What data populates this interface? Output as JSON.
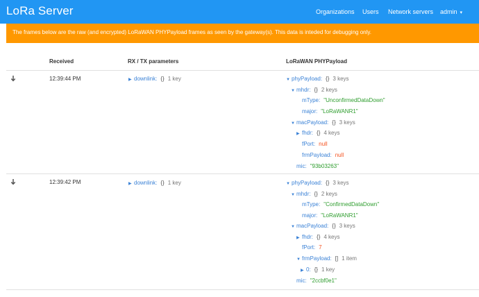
{
  "appbar": {
    "title": "LoRa Server",
    "nav": {
      "organizations": "Organizations",
      "users": "Users",
      "network_servers": "Network servers",
      "account": "admin",
      "account_caret": "▾"
    }
  },
  "banner": {
    "text": "The frames below are the raw (and encrypted) LoRaWAN PHYPayload frames as seen by the gateway(s). This data is inteded for debugging only."
  },
  "table": {
    "headers": {
      "received": "Received",
      "rxtx": "RX / TX parameters",
      "phypayload": "LoRaWAN PHYPayload"
    },
    "rows": [
      {
        "received": "12:39:44 PM",
        "rxtx": {
          "key": "downlink",
          "brace": "{}",
          "meta": "1 key"
        },
        "tree": {
          "phyPayload": {
            "key": "phyPayload",
            "brace": "{}",
            "meta": "3 keys"
          },
          "mhdr": {
            "key": "mhdr",
            "brace": "{}",
            "meta": "2 keys"
          },
          "mType": {
            "key": "mType",
            "value": "\"UnconfirmedDataDown\""
          },
          "major": {
            "key": "major",
            "value": "\"LoRaWANR1\""
          },
          "macPayload": {
            "key": "macPayload",
            "brace": "{}",
            "meta": "3 keys"
          },
          "fhdr": {
            "key": "fhdr",
            "brace": "{}",
            "meta": "4 keys"
          },
          "fPort": {
            "key": "fPort",
            "value": "null"
          },
          "frmPayload": {
            "key": "frmPayload",
            "value": "null"
          },
          "mic": {
            "key": "mic",
            "value": "\"93b03263\""
          }
        }
      },
      {
        "received": "12:39:42 PM",
        "rxtx": {
          "key": "downlink",
          "brace": "{}",
          "meta": "1 key"
        },
        "tree": {
          "phyPayload": {
            "key": "phyPayload",
            "brace": "{}",
            "meta": "3 keys"
          },
          "mhdr": {
            "key": "mhdr",
            "brace": "{}",
            "meta": "2 keys"
          },
          "mType": {
            "key": "mType",
            "value": "\"ConfirmedDataDown\""
          },
          "major": {
            "key": "major",
            "value": "\"LoRaWANR1\""
          },
          "macPayload": {
            "key": "macPayload",
            "brace": "{}",
            "meta": "3 keys"
          },
          "fhdr": {
            "key": "fhdr",
            "brace": "{}",
            "meta": "4 keys"
          },
          "fPort": {
            "key": "fPort",
            "value": "7"
          },
          "frmPayload": {
            "key": "frmPayload",
            "brace": "[]",
            "meta": "1 item"
          },
          "item0": {
            "key": "0",
            "brace": "{}",
            "meta": "1 key"
          },
          "mic": {
            "key": "mic",
            "value": "\"2ccbf0e1\""
          }
        }
      }
    ]
  },
  "icons": {
    "expand": "arrow-down-icon",
    "collapsed": "caret-right-icon",
    "expanded": "caret-down-icon"
  },
  "colors": {
    "appbar": "#2196f3",
    "banner": "#ff9800",
    "json_key": "#3b82d6",
    "json_string": "#2e9d2e",
    "json_null_number": "#f4511e"
  }
}
